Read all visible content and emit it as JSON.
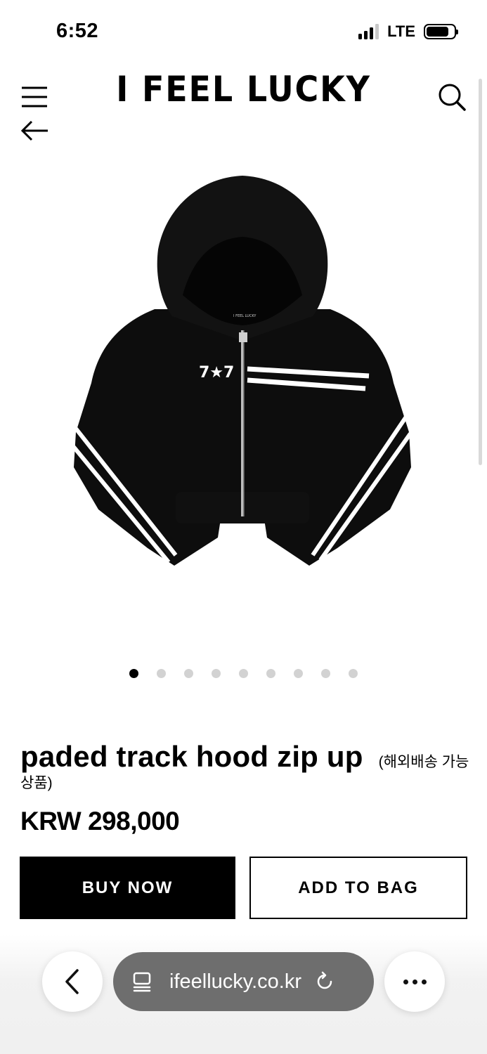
{
  "status": {
    "time": "6:52",
    "network": "LTE",
    "signal_bars": 4,
    "signal_active": 3,
    "battery_level": 0.82
  },
  "header": {
    "brand": "I FEEL LUCKY",
    "icons": [
      "menu-icon",
      "back-arrow-icon",
      "search-icon"
    ]
  },
  "gallery": {
    "image_name": "black padded track hood zip-up jacket",
    "image_print": "7★7",
    "image_tag": "I FEEL LUCKY",
    "total_images": 9,
    "active_index": 0
  },
  "product": {
    "name": "paded track hood zip up",
    "note": "(해외배송 가능상품)",
    "price": "KRW 298,000"
  },
  "actions": {
    "buy_now": "BUY NOW",
    "add_to_bag": "ADD TO BAG"
  },
  "browser": {
    "url": "ifeellucky.co.kr",
    "icons": [
      "back-chevron-icon",
      "tabs-icon",
      "reload-icon",
      "more-icon"
    ]
  },
  "colors": {
    "primary": "#000000",
    "background": "#ffffff",
    "url_pill": "#6e6e6e",
    "dot_inactive": "#d2d2d2"
  }
}
